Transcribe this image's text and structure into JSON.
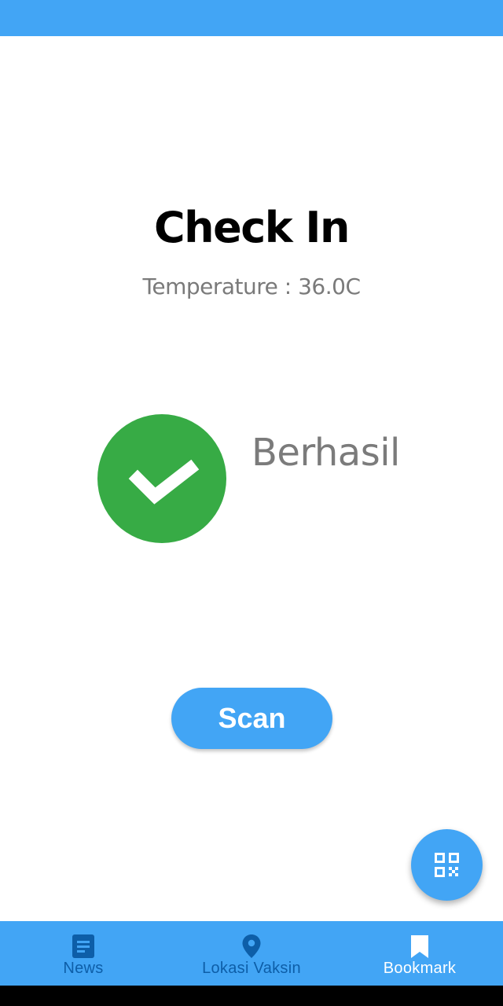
{
  "header": {
    "title": "Check In",
    "temperature": "Temperature : 36.0C"
  },
  "result": {
    "status_text": "Berhasil",
    "icon": "check-circle-icon",
    "color": "#37AB45"
  },
  "actions": {
    "scan_label": "Scan",
    "fab_icon": "qr-code-icon"
  },
  "bottom_nav": {
    "items": [
      {
        "label": "News",
        "icon": "news-icon",
        "active": false
      },
      {
        "label": "Lokasi Vaksin",
        "icon": "location-pin-icon",
        "active": false
      },
      {
        "label": "Bookmark",
        "icon": "bookmark-icon",
        "active": true
      }
    ]
  },
  "colors": {
    "primary": "#42A5F5",
    "inactive_nav": "#0D5EA8",
    "success": "#37AB45",
    "text_muted": "#7B7B7B"
  }
}
